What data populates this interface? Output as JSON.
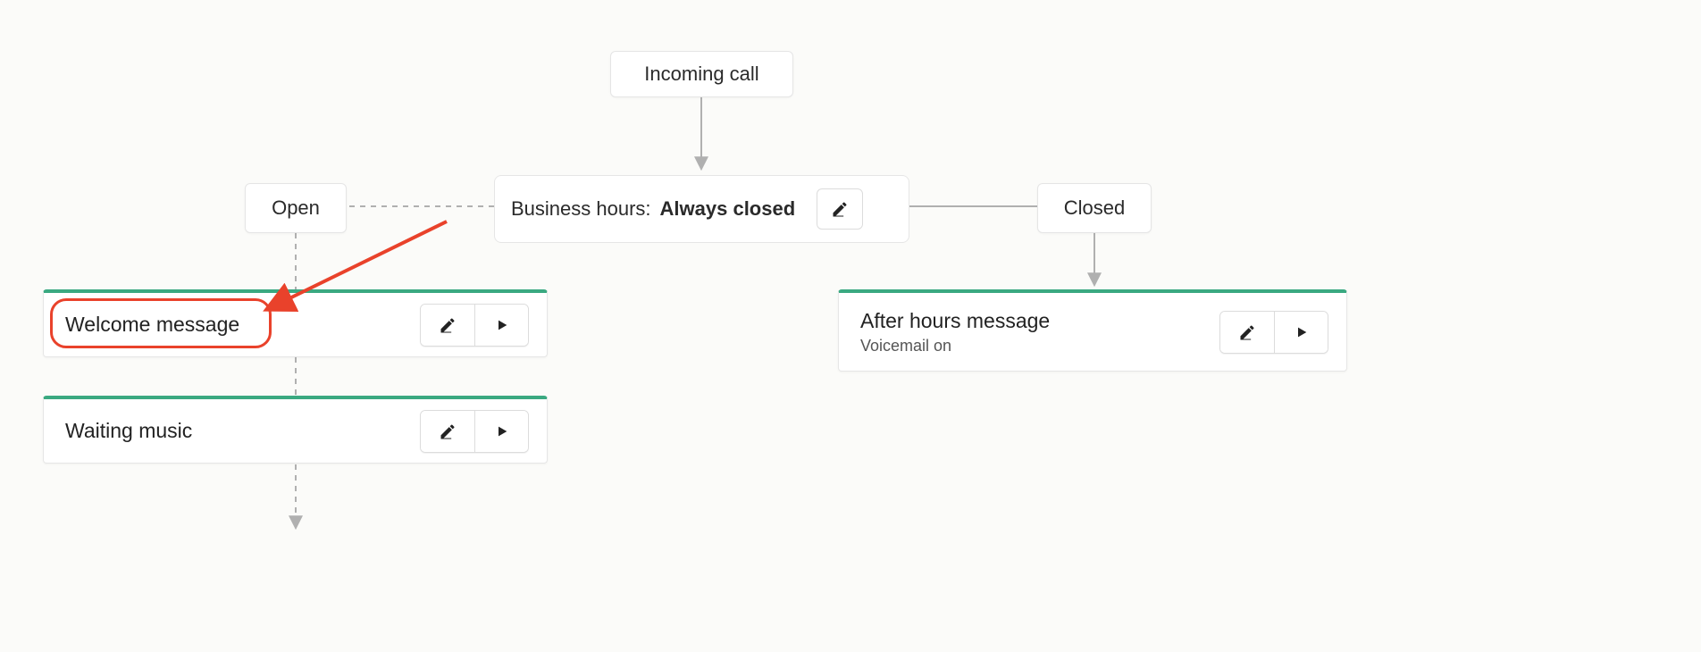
{
  "nodes": {
    "incoming_call": "Incoming call",
    "open": "Open",
    "closed": "Closed"
  },
  "business_hours": {
    "label": "Business hours:",
    "value": "Always closed"
  },
  "cards": {
    "welcome": {
      "title": "Welcome message"
    },
    "waiting": {
      "title": "Waiting music"
    },
    "after_hours": {
      "title": "After hours message",
      "subtitle": "Voicemail on"
    }
  },
  "annotations": {
    "highlight_target": "Welcome message"
  },
  "colors": {
    "accent_green": "#3aa981",
    "annotation_red": "#e9422b"
  }
}
